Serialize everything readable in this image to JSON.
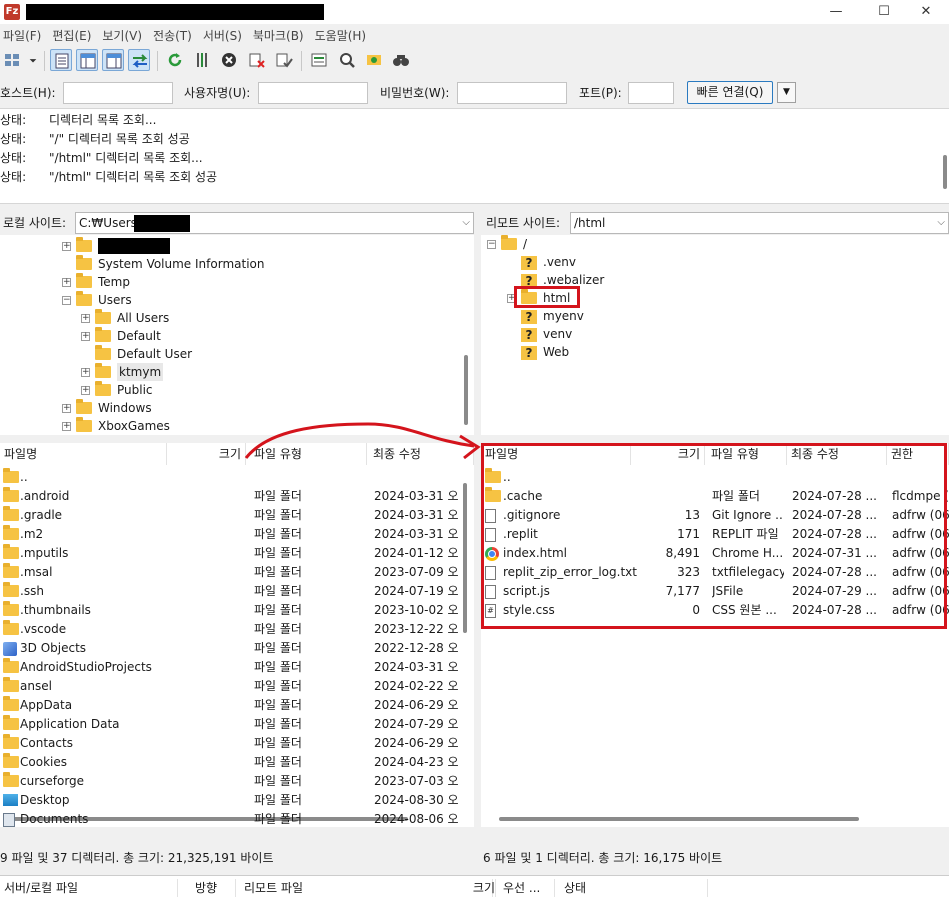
{
  "window": {
    "app_icon_label": "Fz",
    "minimize": "—",
    "maximize": "☐",
    "close": "✕"
  },
  "menu": [
    "파일(F)",
    "편집(E)",
    "보기(V)",
    "전송(T)",
    "서버(S)",
    "북마크(B)",
    "도움말(H)"
  ],
  "toolbar": {
    "icons": [
      "site-manager-icon",
      "message-log-icon",
      "local-tree-icon",
      "remote-tree-icon",
      "transfer-queue-icon",
      "refresh-icon",
      "process-queue-icon",
      "cancel-icon",
      "disconnect-icon",
      "reconnect-icon",
      "directory-filter-icon",
      "search-icon",
      "sync-browse-icon",
      "compare-icon"
    ]
  },
  "quickconnect": {
    "host_label": "호스트(H):",
    "user_label": "사용자명(U):",
    "password_label": "비밀번호(W):",
    "port_label": "포트(P):",
    "host_value": "",
    "user_value": "",
    "password_value": "",
    "port_value": "",
    "button": "빠른 연결(Q)",
    "dropdown_glyph": "▼"
  },
  "log": [
    {
      "label": "상태:",
      "message": "디렉터리 목록 조회..."
    },
    {
      "label": "상태:",
      "message": "\"/\" 디렉터리 목록 조회 성공"
    },
    {
      "label": "상태:",
      "message": "\"/html\" 디렉터리 목록 조회..."
    },
    {
      "label": "상태:",
      "message": "\"/html\" 디렉터리 목록 조회 성공"
    }
  ],
  "local": {
    "site_label": "로컬 사이트:",
    "path": "C:₩Users₩",
    "tree": [
      {
        "name": "",
        "redacted": true,
        "expander": "+"
      },
      {
        "name": "System Volume Information",
        "expander": ""
      },
      {
        "name": "Temp",
        "expander": "+"
      },
      {
        "name": "Users",
        "expander": "−"
      },
      {
        "name": "All Users",
        "expander": "+"
      },
      {
        "name": "Default",
        "expander": "+"
      },
      {
        "name": "Default User",
        "expander": ""
      },
      {
        "name": "ktmym",
        "expander": "+",
        "selected": true
      },
      {
        "name": "Public",
        "expander": "+"
      },
      {
        "name": "Windows",
        "expander": "+"
      },
      {
        "name": "XboxGames",
        "expander": "+"
      }
    ],
    "columns": {
      "name": "파일명",
      "size": "크기",
      "type": "파일 유형",
      "modified": "최종 수정"
    },
    "sort_glyph": "^",
    "files": [
      {
        "name": "..",
        "icon": "folder",
        "type": "",
        "modified": ""
      },
      {
        "name": ".android",
        "icon": "folder",
        "type": "파일 폴더",
        "modified": "2024-03-31 오"
      },
      {
        "name": ".gradle",
        "icon": "folder",
        "type": "파일 폴더",
        "modified": "2024-03-31 오"
      },
      {
        "name": ".m2",
        "icon": "folder",
        "type": "파일 폴더",
        "modified": "2024-03-31 오"
      },
      {
        "name": ".mputils",
        "icon": "folder",
        "type": "파일 폴더",
        "modified": "2024-01-12 오"
      },
      {
        "name": ".msal",
        "icon": "folder",
        "type": "파일 폴더",
        "modified": "2023-07-09 오"
      },
      {
        "name": ".ssh",
        "icon": "folder",
        "type": "파일 폴더",
        "modified": "2024-07-19 오"
      },
      {
        "name": ".thumbnails",
        "icon": "folder",
        "type": "파일 폴더",
        "modified": "2023-10-02 오"
      },
      {
        "name": ".vscode",
        "icon": "folder",
        "type": "파일 폴더",
        "modified": "2023-12-22 오"
      },
      {
        "name": "3D Objects",
        "icon": "cube",
        "type": "파일 폴더",
        "modified": "2022-12-28 오"
      },
      {
        "name": "AndroidStudioProjects",
        "icon": "folder",
        "type": "파일 폴더",
        "modified": "2024-03-31 오"
      },
      {
        "name": "ansel",
        "icon": "folder",
        "type": "파일 폴더",
        "modified": "2024-02-22 오"
      },
      {
        "name": "AppData",
        "icon": "folder",
        "type": "파일 폴더",
        "modified": "2024-06-29 오"
      },
      {
        "name": "Application Data",
        "icon": "folder",
        "type": "파일 폴더",
        "modified": "2024-07-29 오"
      },
      {
        "name": "Contacts",
        "icon": "folder",
        "type": "파일 폴더",
        "modified": "2024-06-29 오"
      },
      {
        "name": "Cookies",
        "icon": "folder",
        "type": "파일 폴더",
        "modified": "2024-04-23 오"
      },
      {
        "name": "curseforge",
        "icon": "folder",
        "type": "파일 폴더",
        "modified": "2023-07-03 오"
      },
      {
        "name": "Desktop",
        "icon": "desktop",
        "type": "파일 폴더",
        "modified": "2024-08-30 오"
      },
      {
        "name": "Documents",
        "icon": "doc",
        "type": "파일 폴더",
        "modified": "2024-08-06 오"
      }
    ],
    "status": "9 파일 및 37 디렉터리. 총 크기: 21,325,191 바이트"
  },
  "remote": {
    "site_label": "리모트 사이트:",
    "path": "/html",
    "tree": [
      {
        "name": "/",
        "icon": "folder",
        "expander": "−"
      },
      {
        "name": ".venv",
        "icon": "qfolder",
        "expander": ""
      },
      {
        "name": ".webalizer",
        "icon": "qfolder",
        "expander": ""
      },
      {
        "name": "html",
        "icon": "folder",
        "expander": "+",
        "selected": true
      },
      {
        "name": "myenv",
        "icon": "qfolder",
        "expander": ""
      },
      {
        "name": "venv",
        "icon": "qfolder",
        "expander": ""
      },
      {
        "name": "Web",
        "icon": "qfolder",
        "expander": ""
      }
    ],
    "columns": {
      "name": "파일명",
      "size": "크기",
      "type": "파일 유형",
      "modified": "최종 수정",
      "permissions": "권한"
    },
    "sort_glyph": "^",
    "files": [
      {
        "name": "..",
        "icon": "folder",
        "size": "",
        "type": "",
        "modified": "",
        "permissions": ""
      },
      {
        "name": ".cache",
        "icon": "folder",
        "size": "",
        "type": "파일 폴더",
        "modified": "2024-07-28 ...",
        "permissions": "flcdmpe (0"
      },
      {
        "name": ".gitignore",
        "icon": "file",
        "size": "13",
        "type": "Git Ignore ...",
        "modified": "2024-07-28 ...",
        "permissions": "adfrw (06"
      },
      {
        "name": ".replit",
        "icon": "file",
        "size": "171",
        "type": "REPLIT 파일",
        "modified": "2024-07-28 ...",
        "permissions": "adfrw (06"
      },
      {
        "name": "index.html",
        "icon": "chrome",
        "size": "8,491",
        "type": "Chrome H...",
        "modified": "2024-07-31 ...",
        "permissions": "adfrw (06"
      },
      {
        "name": "replit_zip_error_log.txt",
        "icon": "file",
        "size": "323",
        "type": "txtfilelegacy",
        "modified": "2024-07-28 ...",
        "permissions": "adfrw (06"
      },
      {
        "name": "script.js",
        "icon": "file",
        "size": "7,177",
        "type": "JSFile",
        "modified": "2024-07-29 ...",
        "permissions": "adfrw (06"
      },
      {
        "name": "style.css",
        "icon": "css",
        "size": "0",
        "type": "CSS 원본 ...",
        "modified": "2024-07-28 ...",
        "permissions": "adfrw (06"
      }
    ],
    "status": "6 파일 및 1 디렉터리. 총 크기: 16,175 바이트"
  },
  "queue": {
    "columns": [
      "서버/로컬 파일",
      "방향",
      "리모트 파일",
      "크기",
      "우선 ...",
      "상태"
    ]
  },
  "annotation_color": "#d4141c"
}
